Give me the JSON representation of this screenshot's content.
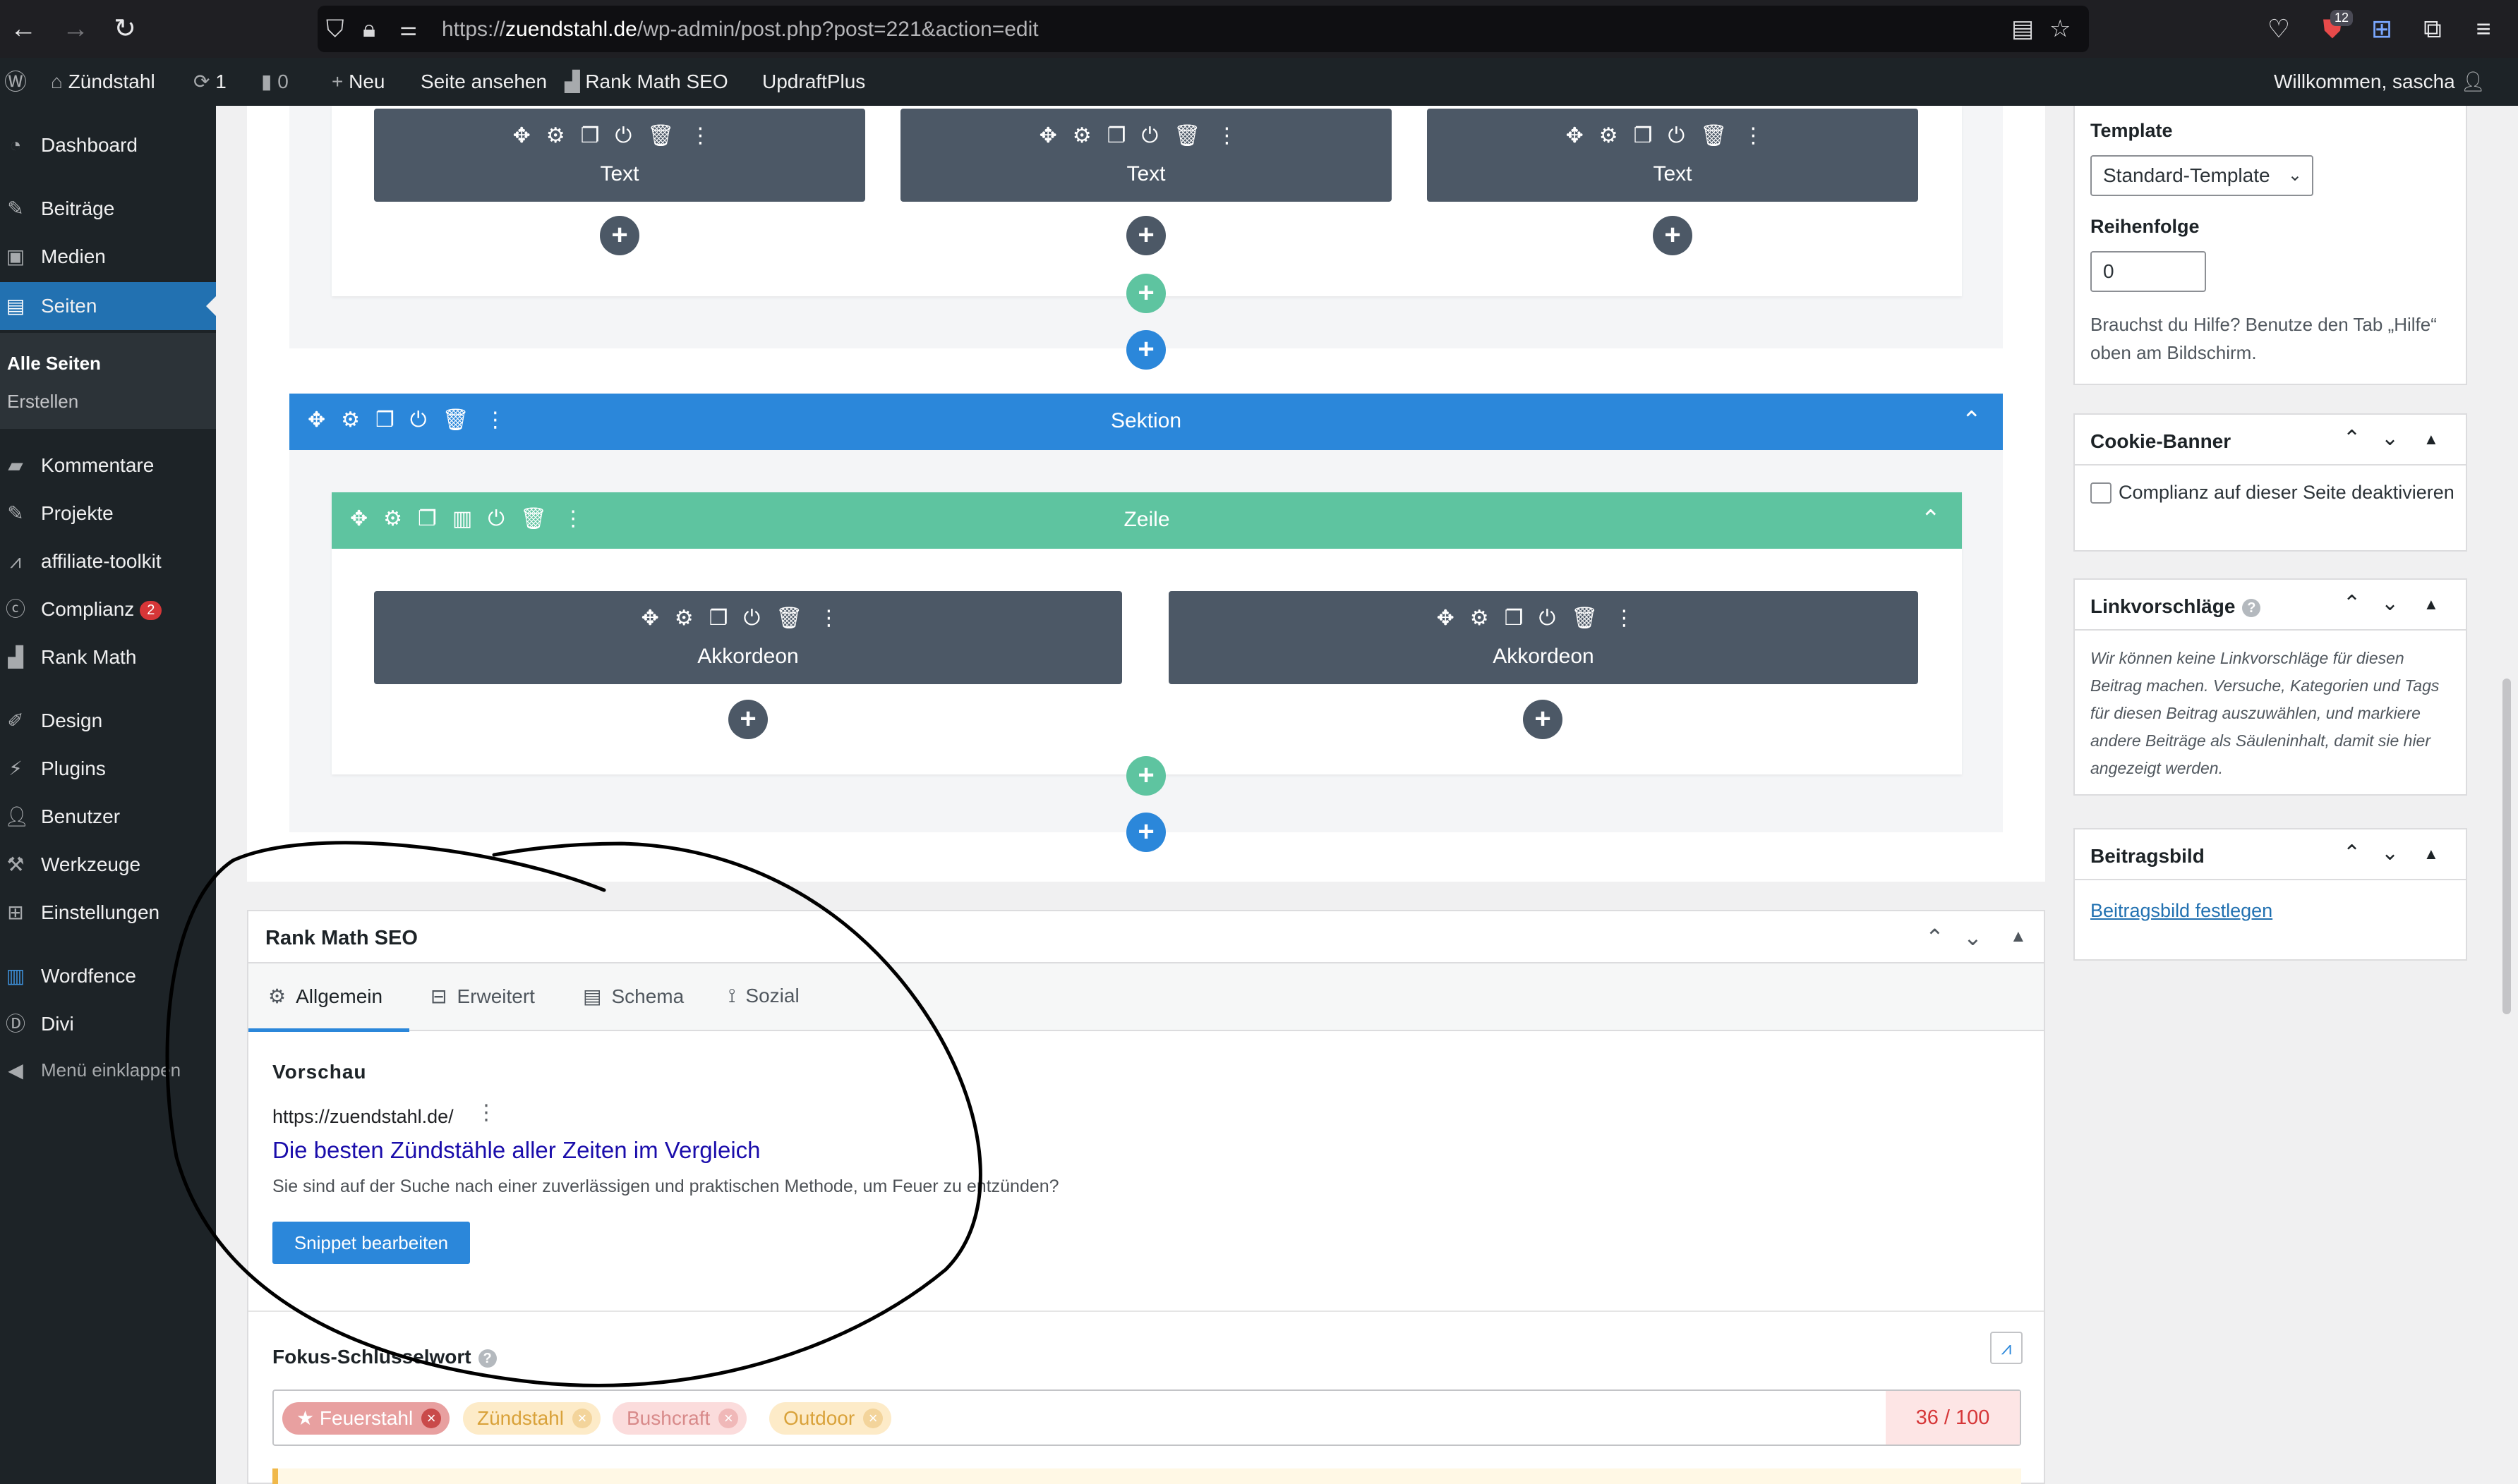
{
  "browser": {
    "url_prefix": "https://",
    "url_domain": "zuendstahl.de",
    "url_path": "/wp-admin/post.php?post=221&action=edit",
    "ext_badge": "12"
  },
  "adminbar": {
    "site_name": "Zündstahl",
    "updates_count": "1",
    "comments_count": "0",
    "new_label": "Neu",
    "view_page_label": "Seite ansehen",
    "rankmath_label": "Rank Math SEO",
    "updraft_label": "UpdraftPlus",
    "welcome": "Willkommen, sascha"
  },
  "sidebar": {
    "items": [
      {
        "label": "Dashboard"
      },
      {
        "label": "Beiträge"
      },
      {
        "label": "Medien"
      },
      {
        "label": "Seiten"
      },
      {
        "label": "Kommentare"
      },
      {
        "label": "Projekte"
      },
      {
        "label": "affiliate-toolkit"
      },
      {
        "label": "Complianz",
        "badge": "2"
      },
      {
        "label": "Rank Math"
      },
      {
        "label": "Design"
      },
      {
        "label": "Plugins"
      },
      {
        "label": "Benutzer"
      },
      {
        "label": "Werkzeuge"
      },
      {
        "label": "Einstellungen"
      },
      {
        "label": "Wordfence"
      },
      {
        "label": "Divi"
      },
      {
        "label": "Menü einklappen"
      }
    ],
    "submenu": [
      "Alle Seiten",
      "Erstellen"
    ]
  },
  "builder": {
    "module_text": "Text",
    "section_label": "Sektion",
    "row_label": "Zeile",
    "module_accordion": "Akkordeon"
  },
  "rankmath": {
    "title": "Rank Math SEO",
    "tabs": [
      "Allgemein",
      "Erweitert",
      "Schema",
      "Sozial"
    ],
    "preview_label": "Vorschau",
    "snippet_url": "https://zuendstahl.de/",
    "snippet_title": "Die besten Zündstähle aller Zeiten im Vergleich",
    "snippet_desc": "Sie sind auf der Suche nach einer zuverlässigen und praktischen Methode, um Feuer zu entzünden?",
    "edit_snippet": "Snippet bearbeiten",
    "focus_label": "Fokus-Schlüsselwort",
    "keywords": [
      "Feuerstahl",
      "Zündstahl",
      "Bushcraft",
      "Outdoor"
    ],
    "score": "36 / 100"
  },
  "side": {
    "template_label": "Template",
    "template_value": "Standard-Template",
    "order_label": "Reihenfolge",
    "order_value": "0",
    "help_text": "Brauchst du Hilfe? Benutze den Tab „Hilfe“ oben am Bildschirm.",
    "cookie_title": "Cookie-Banner",
    "cookie_checkbox": "Complianz auf dieser Seite deaktivieren",
    "link_title": "Linkvorschläge",
    "link_text": "Wir können keine Linkvorschläge für diesen Beitrag machen. Versuche, Kategorien und Tags für diesen Beitrag auszuwählen, und markiere andere Beiträge als Säuleninhalt, damit sie hier angezeigt werden.",
    "featured_title": "Beitragsbild",
    "featured_link": "Beitragsbild festlegen"
  },
  "colors": {
    "wp_blue": "#2271b1",
    "divi_blue": "#2b87da",
    "divi_green": "#5ec4a0",
    "module_gray": "#4c5866"
  }
}
